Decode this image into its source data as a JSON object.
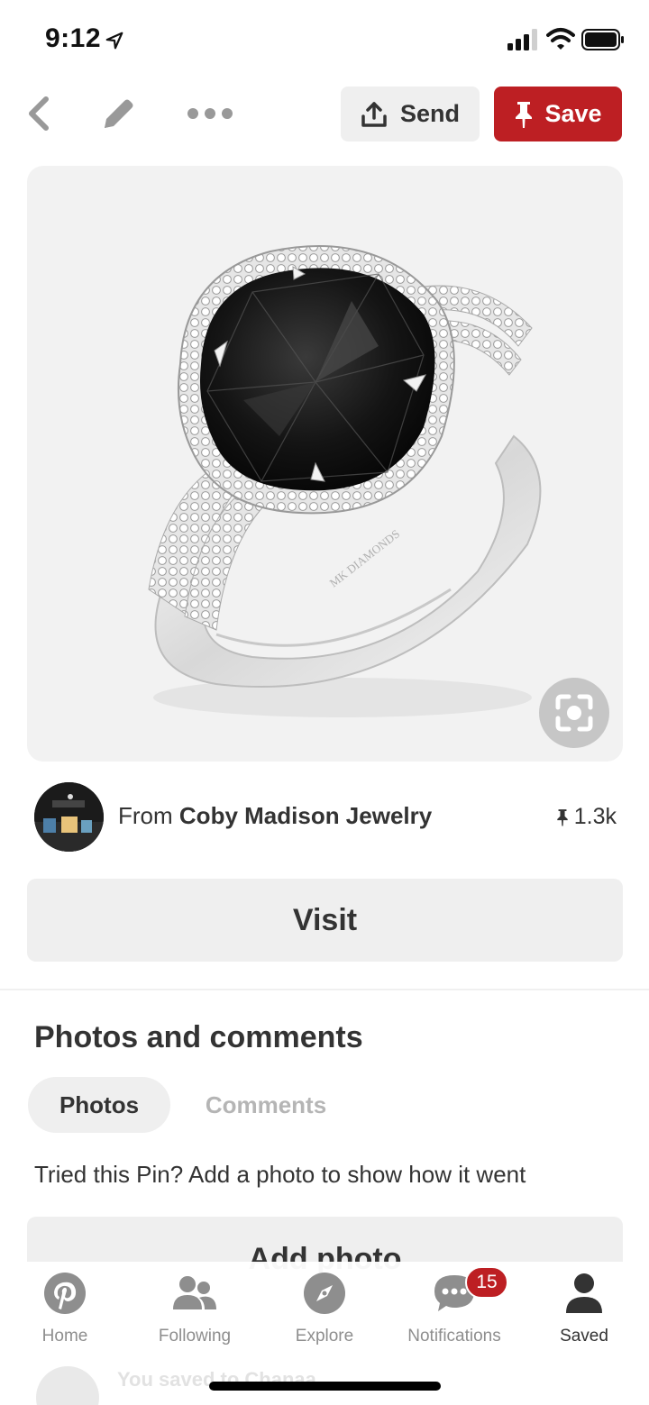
{
  "status_bar": {
    "time": "9:12",
    "icons": [
      "location-arrow-icon",
      "signal-icon",
      "wifi-icon",
      "battery-icon"
    ]
  },
  "toolbar": {
    "icons": [
      "back-chevron-icon",
      "pencil-icon",
      "more-dots-icon"
    ],
    "send_label": "Send",
    "save_label": "Save"
  },
  "pin": {
    "image_watermark": "MK DIAMONDS",
    "lens_icon": "visual-search-icon"
  },
  "source": {
    "from_label": "From",
    "name": "Coby Madison Jewelry",
    "save_count": "1.3k"
  },
  "visit_label": "Visit",
  "comments_section": {
    "title": "Photos and comments",
    "tabs": [
      {
        "label": "Photos",
        "selected": true
      },
      {
        "label": "Comments",
        "selected": false
      }
    ],
    "prompt": "Tried this Pin? Add a photo to show how it went",
    "add_photo_label": "Add photo"
  },
  "below_fold": {
    "text": "You saved to Chanaa"
  },
  "tab_bar": {
    "items": [
      {
        "label": "Home",
        "icon": "pinterest-logo-icon"
      },
      {
        "label": "Following",
        "icon": "people-icon"
      },
      {
        "label": "Explore",
        "icon": "compass-icon"
      },
      {
        "label": "Notifications",
        "icon": "chat-bubble-icon",
        "badge": "15"
      },
      {
        "label": "Saved",
        "icon": "profile-icon",
        "active": true
      }
    ]
  },
  "colors": {
    "brand_red": "#bd1f23",
    "button_gray": "#efefef",
    "text_dark": "#333333",
    "inactive_tab": "#8e8e8e"
  }
}
